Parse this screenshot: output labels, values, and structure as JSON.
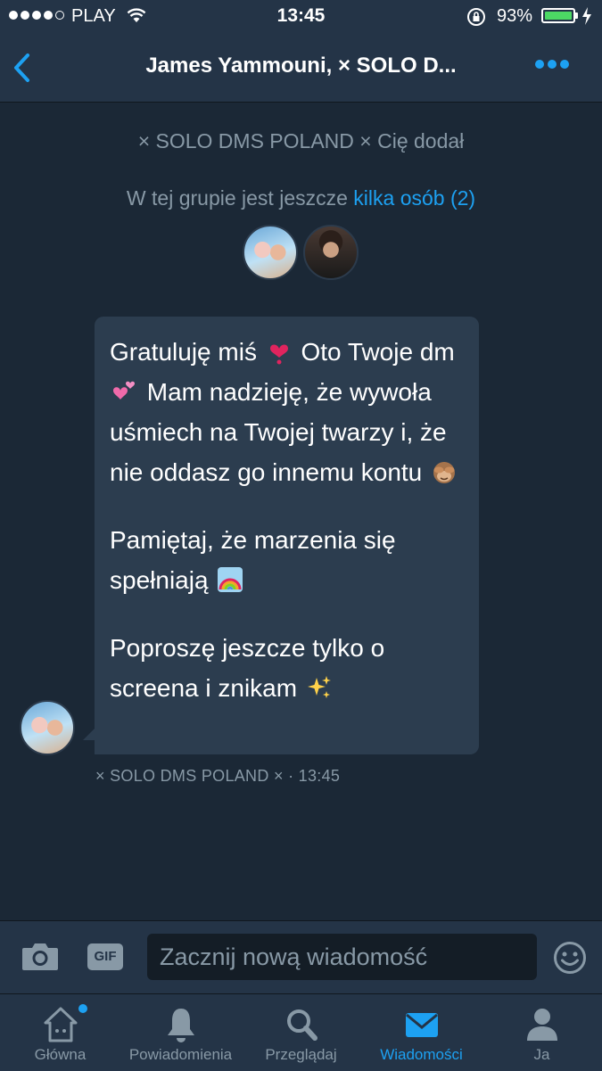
{
  "status_bar": {
    "carrier": "PLAY",
    "time": "13:45",
    "battery": "93%"
  },
  "nav": {
    "title": "James Yammouni, × SOLO D..."
  },
  "conversation": {
    "added_note": "× SOLO DMS POLAND × Cię dodał",
    "group_note_prefix": "W tej grupie jest jeszcze ",
    "group_note_link": "kilka osób (2)"
  },
  "message": {
    "p1a": "Gratuluję miś ",
    "p1b": " Oto Twoje dm ",
    "p1c": " Mam nadzieję, że wywoła uśmiech na Twojej twarzy i, że nie oddasz go innemu kontu ",
    "p2": "Pamiętaj, że marzenia się spełniają ",
    "p3": "Poproszę jeszcze tylko o screena i znikam ",
    "meta": "× SOLO DMS POLAND × · 13:45"
  },
  "composer": {
    "gif_label": "GIF",
    "placeholder": "Zacznij nową wiadomość"
  },
  "tabs": [
    {
      "label": "Główna",
      "icon": "home-icon"
    },
    {
      "label": "Powiadomienia",
      "icon": "bell-icon"
    },
    {
      "label": "Przeglądaj",
      "icon": "search-icon"
    },
    {
      "label": "Wiadomości",
      "icon": "envelope-icon",
      "active": true
    },
    {
      "label": "Ja",
      "icon": "person-icon"
    }
  ],
  "colors": {
    "background": "#1b2836",
    "bar": "#243447",
    "bubble": "#2c3d4f",
    "accent": "#1da1f2",
    "muted": "#8899a6"
  }
}
